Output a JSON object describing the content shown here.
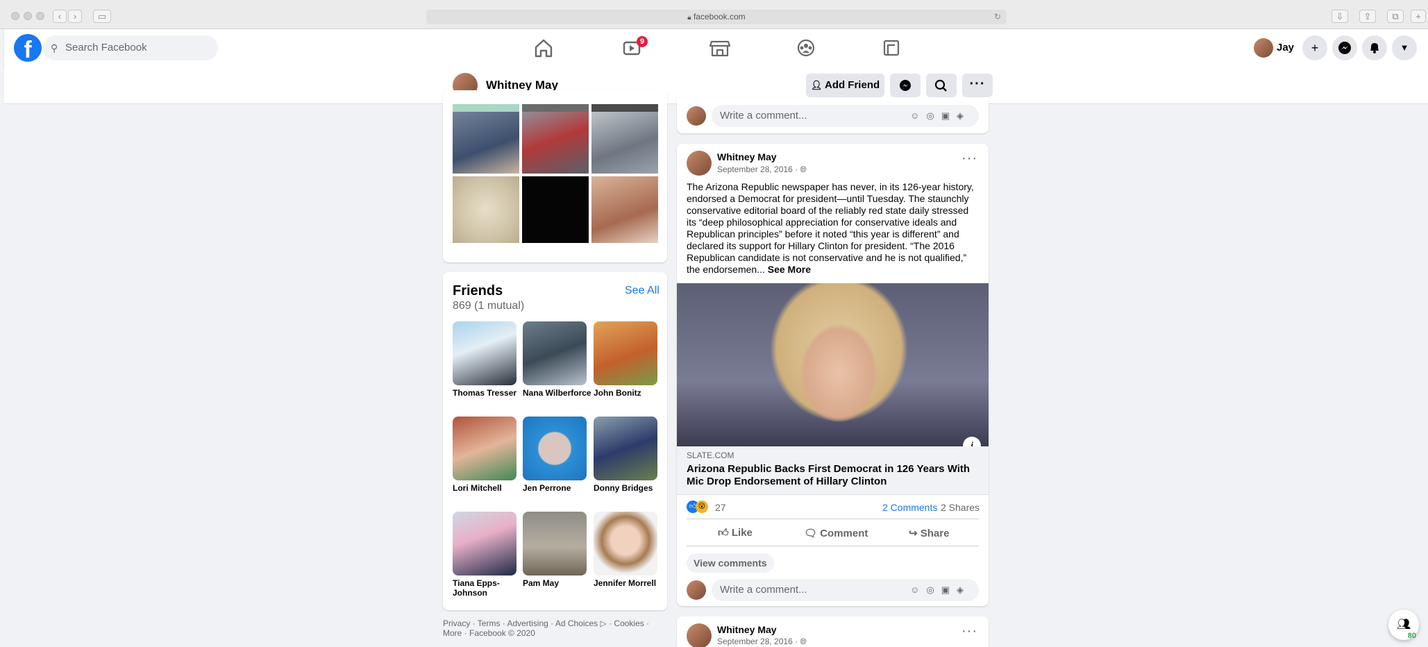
{
  "browser": {
    "url": "facebook.com"
  },
  "topbar": {
    "logo": "f",
    "search_placeholder": "Search Facebook",
    "watch_badge": "9",
    "user_name": "Jay"
  },
  "profile_header": {
    "name": "Whitney May",
    "add_friend": "Add Friend"
  },
  "friends": {
    "title": "Friends",
    "count": "869 (1 mutual)",
    "see_all": "See All",
    "items": [
      {
        "name": "Thomas Tresser"
      },
      {
        "name": "Nana Wilberforce"
      },
      {
        "name": "John Bonitz"
      },
      {
        "name": "Lori Mitchell"
      },
      {
        "name": "Jen Perrone"
      },
      {
        "name": "Donny Bridges"
      },
      {
        "name": "Tiana Epps-Johnson"
      },
      {
        "name": "Pam May"
      },
      {
        "name": "Jennifer Morrell"
      }
    ]
  },
  "footer": {
    "links": "Privacy · Terms · Advertising · Ad Choices ▷ · Cookies ·",
    "line2": "More · Facebook © 2020"
  },
  "comment_placeholder": "Write a comment...",
  "post": {
    "author": "Whitney May",
    "date": "September 28, 2016 ·",
    "body": "The Arizona Republic newspaper has never, in its 126-year history, endorsed a Democrat for president—until Tuesday. The staunchly conservative editorial board of the reliably red state daily stressed its “deep philosophical appreciation for conservative ideals and Republican principles” before it noted “this year is different” and declared its support for Hillary Clinton for president. “The 2016 Republican candidate is not conservative and he is not qualified,” the endorsemen...",
    "see_more": "See More",
    "link_source": "SLATE.COM",
    "link_title": "Arizona Republic Backs First Democrat in 126 Years With Mic Drop Endorsement of Hillary Clinton",
    "reactions_count": "27",
    "comments": "2 Comments",
    "shares": "2 Shares",
    "like": "Like",
    "comment": "Comment",
    "share": "Share",
    "view_comments": "View comments"
  },
  "next_post": {
    "author": "Whitney May",
    "date": "September 28, 2016 ·"
  },
  "corner_badge": "80",
  "colors": {
    "brand": "#1877f2",
    "badge": "#e41e3f"
  }
}
